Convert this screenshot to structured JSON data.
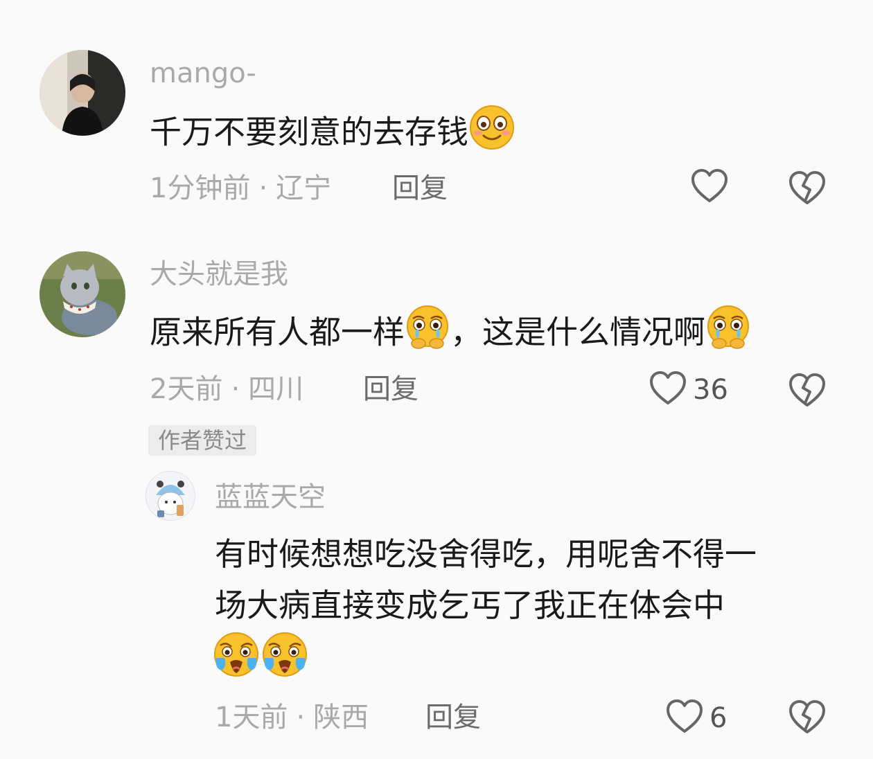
{
  "comments": [
    {
      "username": "mango-",
      "text": "千万不要刻意的去存钱",
      "emoji": "smiling-face-emoji",
      "time": "1分钟前",
      "location": "辽宁",
      "reply_label": "回复",
      "likes": ""
    },
    {
      "username": "大头就是我",
      "text_part1": "原来所有人都一样",
      "text_part2": "，这是什么情况啊",
      "emoji": "pleading-crying-face-emoji",
      "time": "2天前",
      "location": "四川",
      "reply_label": "回复",
      "likes": "36",
      "badge": "作者赞过"
    },
    {
      "username": "蓝蓝天空",
      "text_line1": "有时候想想吃没舍得吃，用呢舍不得一",
      "text_line2": "场大病直接变成乞丐了我正在体会中",
      "emoji": "loudly-crying-face-emoji",
      "time": "1天前",
      "location": "陕西",
      "reply_label": "回复",
      "likes": "6"
    }
  ],
  "separator": "·",
  "colors": {
    "background": "#fafafa",
    "username": "#a9a9a9",
    "text": "#1a1a1a",
    "meta": "#a9a9a9",
    "reply": "#6b6b6b",
    "icon": "#666666"
  }
}
